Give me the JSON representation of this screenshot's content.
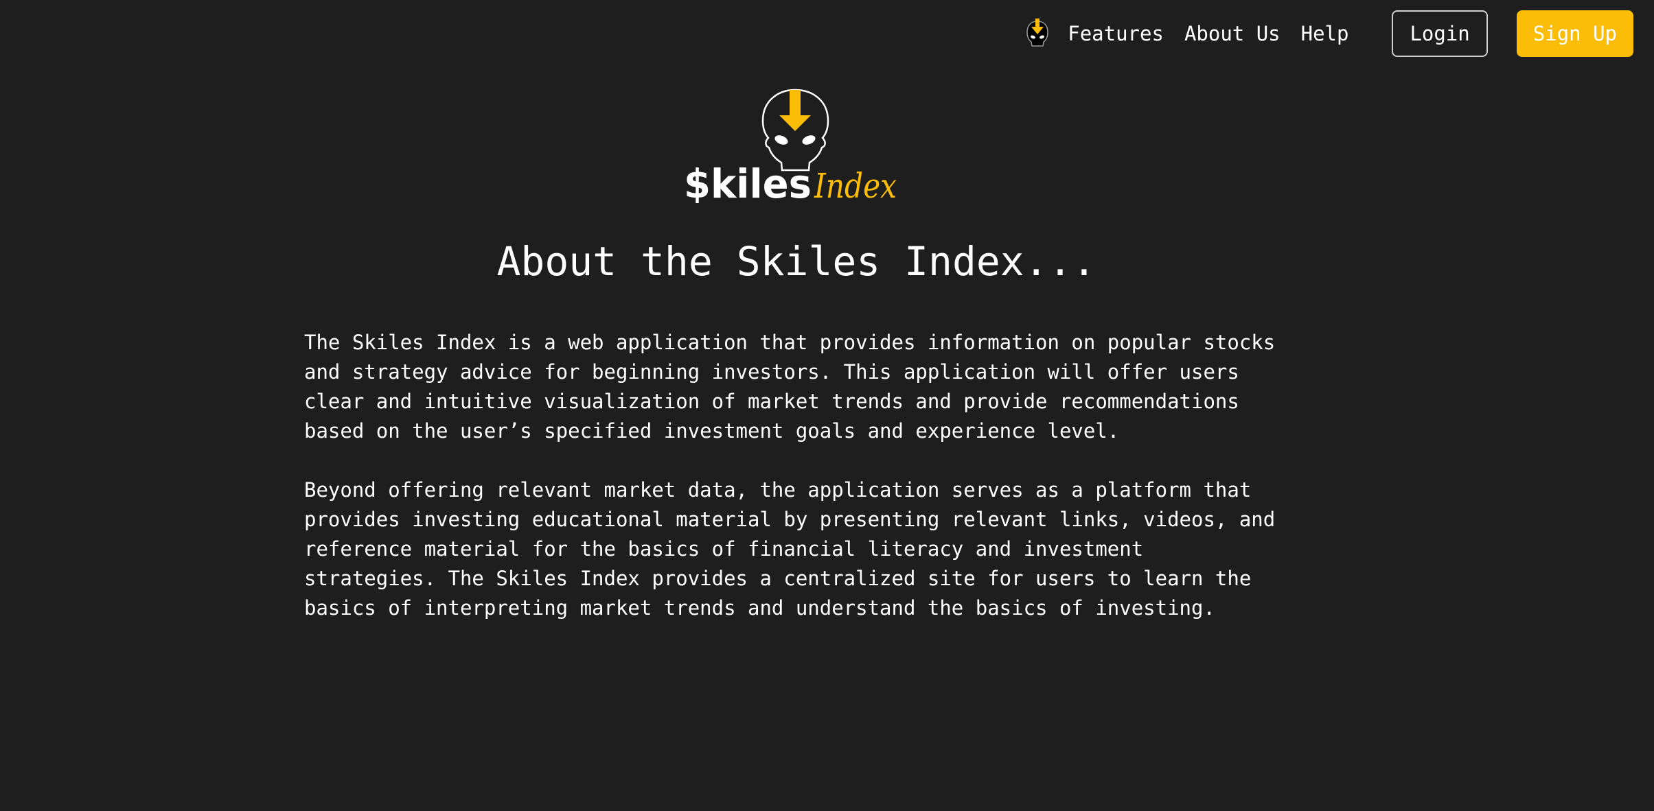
{
  "nav": {
    "logo_icon": "skiles-mascot-icon",
    "links": [
      "Features",
      "About Us",
      "Help"
    ],
    "login_label": "Login",
    "signup_label": "Sign Up"
  },
  "hero": {
    "logo_text_primary": "$kiles",
    "logo_text_secondary": "Index"
  },
  "page": {
    "title": "About the Skiles Index...",
    "paragraphs": [
      "The Skiles Index is a web application that provides information on popular stocks and strategy advice for beginning investors. This application will offer users clear and intuitive visualization of market trends and provide recommendations based on the user’s specified investment goals and experience level.",
      "Beyond offering relevant market data, the application serves as a platform that provides investing educational material by presenting relevant links, videos, and reference material for the basics of financial literacy and investment strategies. The Skiles Index provides a centralized site for users to learn the basics of interpreting market trends and understand the basics of investing."
    ]
  },
  "colors": {
    "background": "#1e1e1e",
    "accent": "#fbbd08",
    "text": "#ffffff"
  }
}
